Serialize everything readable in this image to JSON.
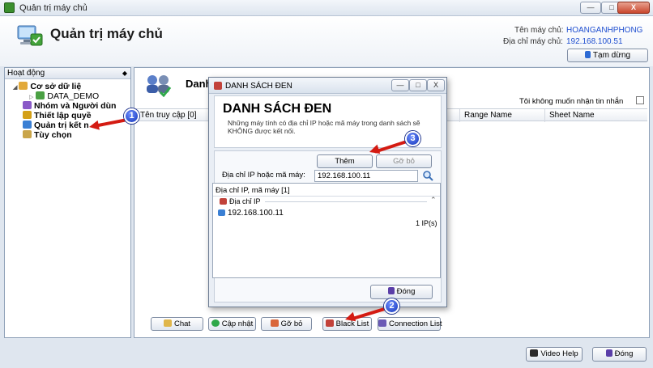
{
  "window": {
    "title": "Quản trị máy chủ",
    "controls": [
      "—",
      "□",
      "X"
    ]
  },
  "header": {
    "app_title": "Quản trị máy chủ",
    "server_name_label": "Tên máy chủ:",
    "server_name": "HOANGANHPHONG",
    "server_addr_label": "Địa chỉ máy chủ:",
    "server_addr": "192.168.100.51",
    "pause_label": "Tạm dừng"
  },
  "sidebar": {
    "header": "Hoạt động",
    "items": [
      {
        "label": "Cơ sở dữ liệ"
      },
      {
        "label": "DATA_DEMO"
      },
      {
        "label": "Nhóm và Người dùn"
      },
      {
        "label": "Thiết lập quyề"
      },
      {
        "label": "Quản trị kết n"
      },
      {
        "label": "Tùy chọn"
      }
    ]
  },
  "main": {
    "title": "Danh",
    "no_messages_label": "Tôi không muốn nhận tin nhắn",
    "columns": [
      "Tên truy cập [0]",
      "Range Name",
      "Sheet Name"
    ],
    "buttons": {
      "chat": "Chat",
      "update": "Cập nhật",
      "remove": "Gỡ bỏ",
      "black_list": "Black List",
      "connection_list": "Connection List"
    }
  },
  "footer": {
    "video_help": "Video Help",
    "close": "Đóng"
  },
  "dialog": {
    "title": "DANH SÁCH ĐEN",
    "heading": "DANH SÁCH ĐEN",
    "description": "Những máy tính có địa chỉ IP hoặc mã máy trong danh sách sẽ KHÔNG được kết nối.",
    "add_label": "Thêm",
    "remove_label": "Gỡ bỏ",
    "input_label": "Địa chỉ IP hoặc mã máy:",
    "input_value": "192.168.100.11",
    "list_header": "Địa chỉ IP, mã máy [1]",
    "group_label": "Địa chỉ IP",
    "entries": [
      "192.168.100.11"
    ],
    "count_label": "1 IP(s)",
    "close_label": "Đóng"
  },
  "annotations": [
    "1",
    "2",
    "3"
  ],
  "colors": {
    "accent_blue": "#1f4fd0",
    "annotation_red": "#d41b12",
    "badge_blue": "#1233b8"
  }
}
